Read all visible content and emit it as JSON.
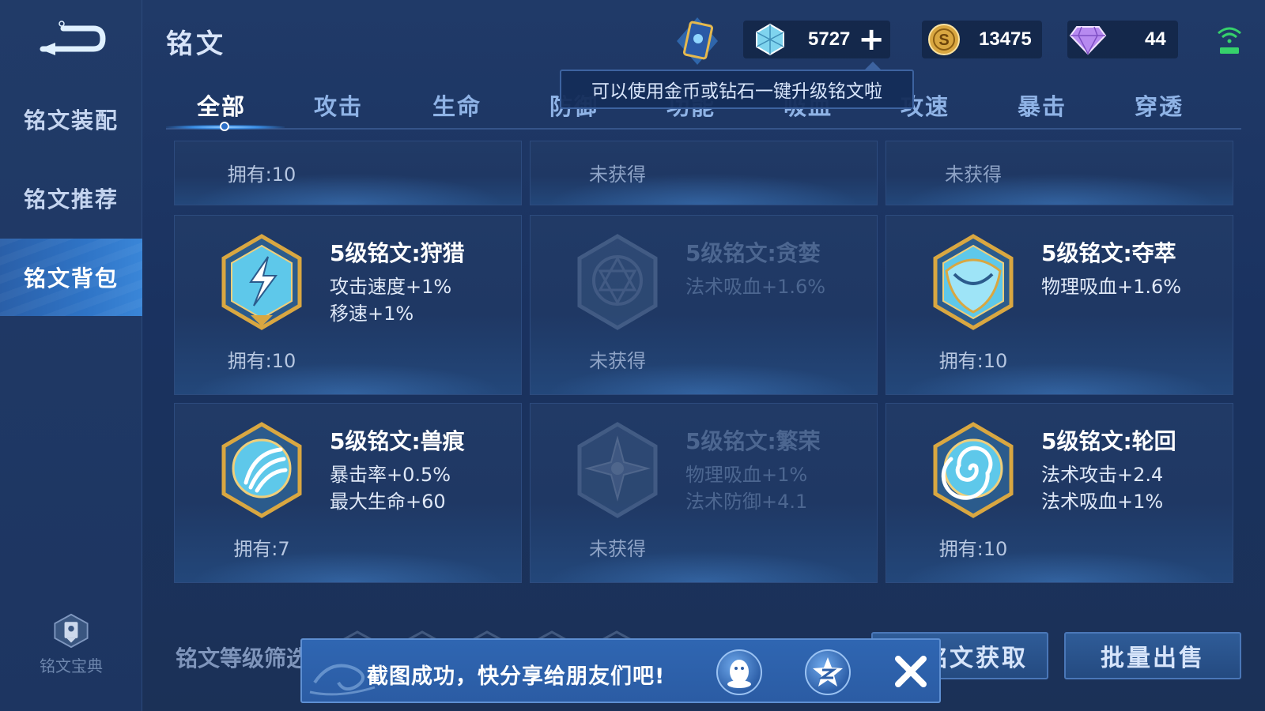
{
  "header": {
    "title": "铭文",
    "currencies": {
      "gem": "5727",
      "gold": "13475",
      "diamond": "44"
    }
  },
  "sidebar": {
    "items": [
      {
        "label": "铭文装配"
      },
      {
        "label": "铭文推荐"
      },
      {
        "label": "铭文背包"
      }
    ],
    "codex_label": "铭文宝典"
  },
  "tabs": [
    {
      "label": "全部"
    },
    {
      "label": "攻击"
    },
    {
      "label": "生命"
    },
    {
      "label": "防御"
    },
    {
      "label": "功能"
    },
    {
      "label": "吸血"
    },
    {
      "label": "攻速"
    },
    {
      "label": "暴击"
    },
    {
      "label": "穿透"
    }
  ],
  "tooltip": "可以使用金币或钻石一键升级铭文啦",
  "inscriptions": {
    "top": [
      {
        "own": "拥有:10"
      },
      {
        "own": "未获得"
      },
      {
        "own": "未获得"
      }
    ],
    "row1": [
      {
        "name": "5级铭文:狩猎",
        "stat1": "攻击速度+1%",
        "stat2": "移速+1%",
        "own": "拥有:10"
      },
      {
        "name": "5级铭文:贪婪",
        "stat1": "法术吸血+1.6%",
        "stat2": "",
        "own": "未获得"
      },
      {
        "name": "5级铭文:夺萃",
        "stat1": "物理吸血+1.6%",
        "stat2": "",
        "own": "拥有:10"
      }
    ],
    "row2": [
      {
        "name": "5级铭文:兽痕",
        "stat1": "暴击率+0.5%",
        "stat2": "最大生命+60",
        "own": "拥有:7"
      },
      {
        "name": "5级铭文:繁荣",
        "stat1": "物理吸血+1%",
        "stat2": "法术防御+4.1",
        "own": "未获得"
      },
      {
        "name": "5级铭文:轮回",
        "stat1": "法术攻击+2.4",
        "stat2": "法术吸血+1%",
        "own": "拥有:10"
      }
    ]
  },
  "bottom": {
    "filter_label": "铭文等级筛选",
    "acquire_label": "铭文获取",
    "sell_label": "批量出售"
  },
  "toast": {
    "text": "截图成功，快分享给朋友们吧!"
  },
  "colors": {
    "background": "#1a3260",
    "accent": "#3a86d8",
    "gold": "#d9a741",
    "emblem_blue": "#5ec8ea"
  }
}
